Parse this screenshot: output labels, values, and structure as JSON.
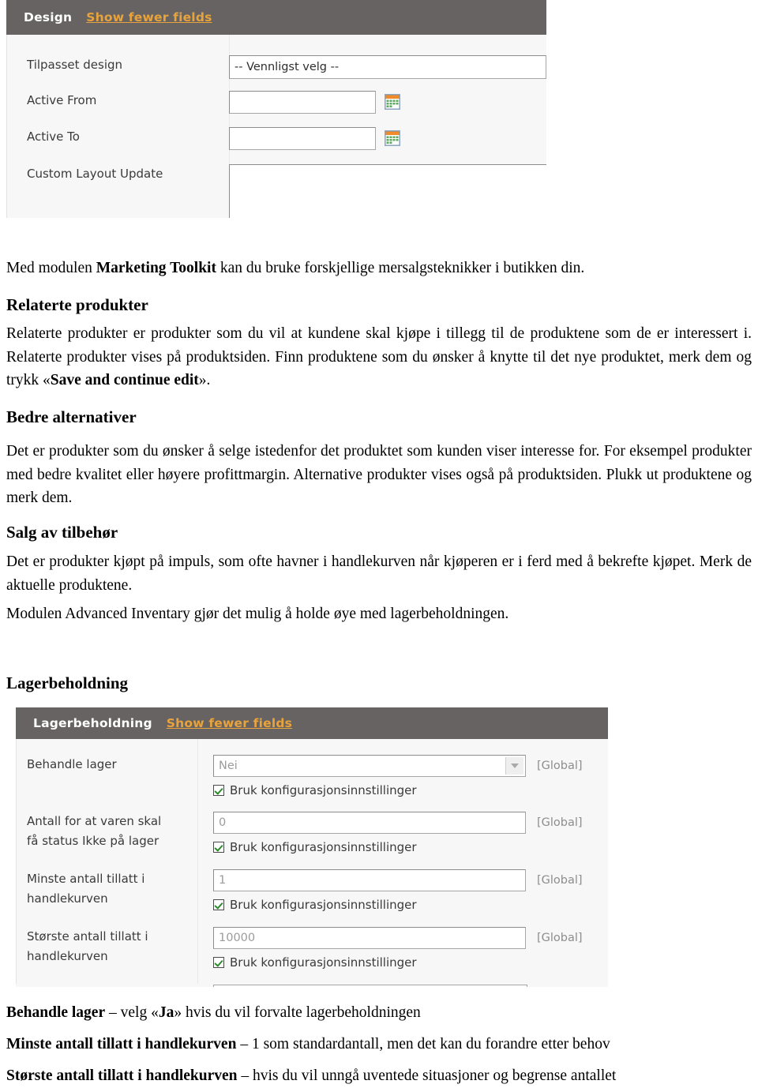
{
  "design_panel": {
    "header": {
      "title": "Design",
      "link": "Show fewer fields"
    },
    "fields": [
      {
        "label": "Tilpasset design",
        "type": "select",
        "value": "-- Vennligst velg --"
      },
      {
        "label": "Active From",
        "type": "text-calendar",
        "value": "",
        "icon": "calendar-icon"
      },
      {
        "label": "Active To",
        "type": "text-calendar",
        "value": "",
        "icon": "calendar-icon"
      },
      {
        "label": "Custom Layout Update",
        "type": "textarea",
        "value": ""
      }
    ]
  },
  "body": {
    "intro_pre": "Med modulen ",
    "intro_bold": "Marketing Toolkit",
    "intro_post": " kan du bruke forskjellige mersalgsteknikker i butikken din.",
    "h_related": "Relaterte produkter",
    "p_related_pre": "Relaterte produkter er produkter som du vil at kundene skal kjøpe i tillegg til de produktene som de er interessert i. Relaterte produkter vises på produktsiden. Finn produktene som du ønsker å knytte til det nye produktet, merk dem og trykk «",
    "p_related_bold": "Save and continue edit",
    "p_related_post": "».",
    "h_better": "Bedre alternativer",
    "p_better": "Det er produkter som du ønsker å selge istedenfor det produktet som kunden viser interesse for. For eksempel produkter med bedre kvalitet eller høyere profittmargin. Alternative produkter vises også på produktsiden. Plukk ut produktene og merk dem.",
    "h_accessory": "Salg av tilbehør",
    "p_accessory": "Det er produkter kjøpt på impuls, som ofte havner i handlekurven når kjøperen er i ferd med å bekrefte kjøpet. Merk de aktuelle produktene.",
    "p_inventory": "Modulen Advanced Inventary gjør det mulig å holde øye med lagerbeholdningen.",
    "h_stock": "Lagerbeholdning"
  },
  "stock_panel": {
    "header": {
      "title": "Lagerbeholdning",
      "link": "Show fewer fields"
    },
    "scope_label": "[Global]",
    "checkbox_label": "Bruk konfigurasjonsinnstillinger",
    "fields": [
      {
        "label": "Behandle lager",
        "type": "select",
        "value": "Nei",
        "scope": "[Global]",
        "checkbox": "Bruk konfigurasjonsinnstillinger",
        "checked": true
      },
      {
        "label": "Antall for at varen skal\nfå status Ikke på lager",
        "type": "text",
        "value": "0",
        "scope": "[Global]",
        "checkbox": "Bruk konfigurasjonsinnstillinger",
        "checked": true
      },
      {
        "label": "Minste antall tillatt i\nhandlekurven",
        "type": "text",
        "value": "1",
        "scope": "[Global]",
        "checkbox": "Bruk konfigurasjonsinnstillinger",
        "checked": true
      },
      {
        "label": "Største antall tillatt i\nhandlekurven",
        "type": "text",
        "value": "10000",
        "scope": "[Global]",
        "checkbox": "Bruk konfigurasjonsinnstillinger",
        "checked": true
      }
    ]
  },
  "footnotes": [
    {
      "bold": "Behandle lager",
      "rest": " – velg «Ja» hvis du vil forvalte lagerbeholdningen",
      "ja_bold": "Ja"
    },
    {
      "bold": "Minste antall tillatt i handlekurven",
      "rest": " – 1 som standardantall, men det kan du forandre etter behov"
    },
    {
      "bold": "Største antall tillatt i handlekurven",
      "rest": " – hvis du vil unngå uventede situasjoner og begrense antallet"
    }
  ],
  "colors": {
    "panel_header_bg": "#666362",
    "panel_link": "#e8a33d",
    "panel_bg": "#f7f7f7",
    "check_green": "#2f8a2f"
  }
}
